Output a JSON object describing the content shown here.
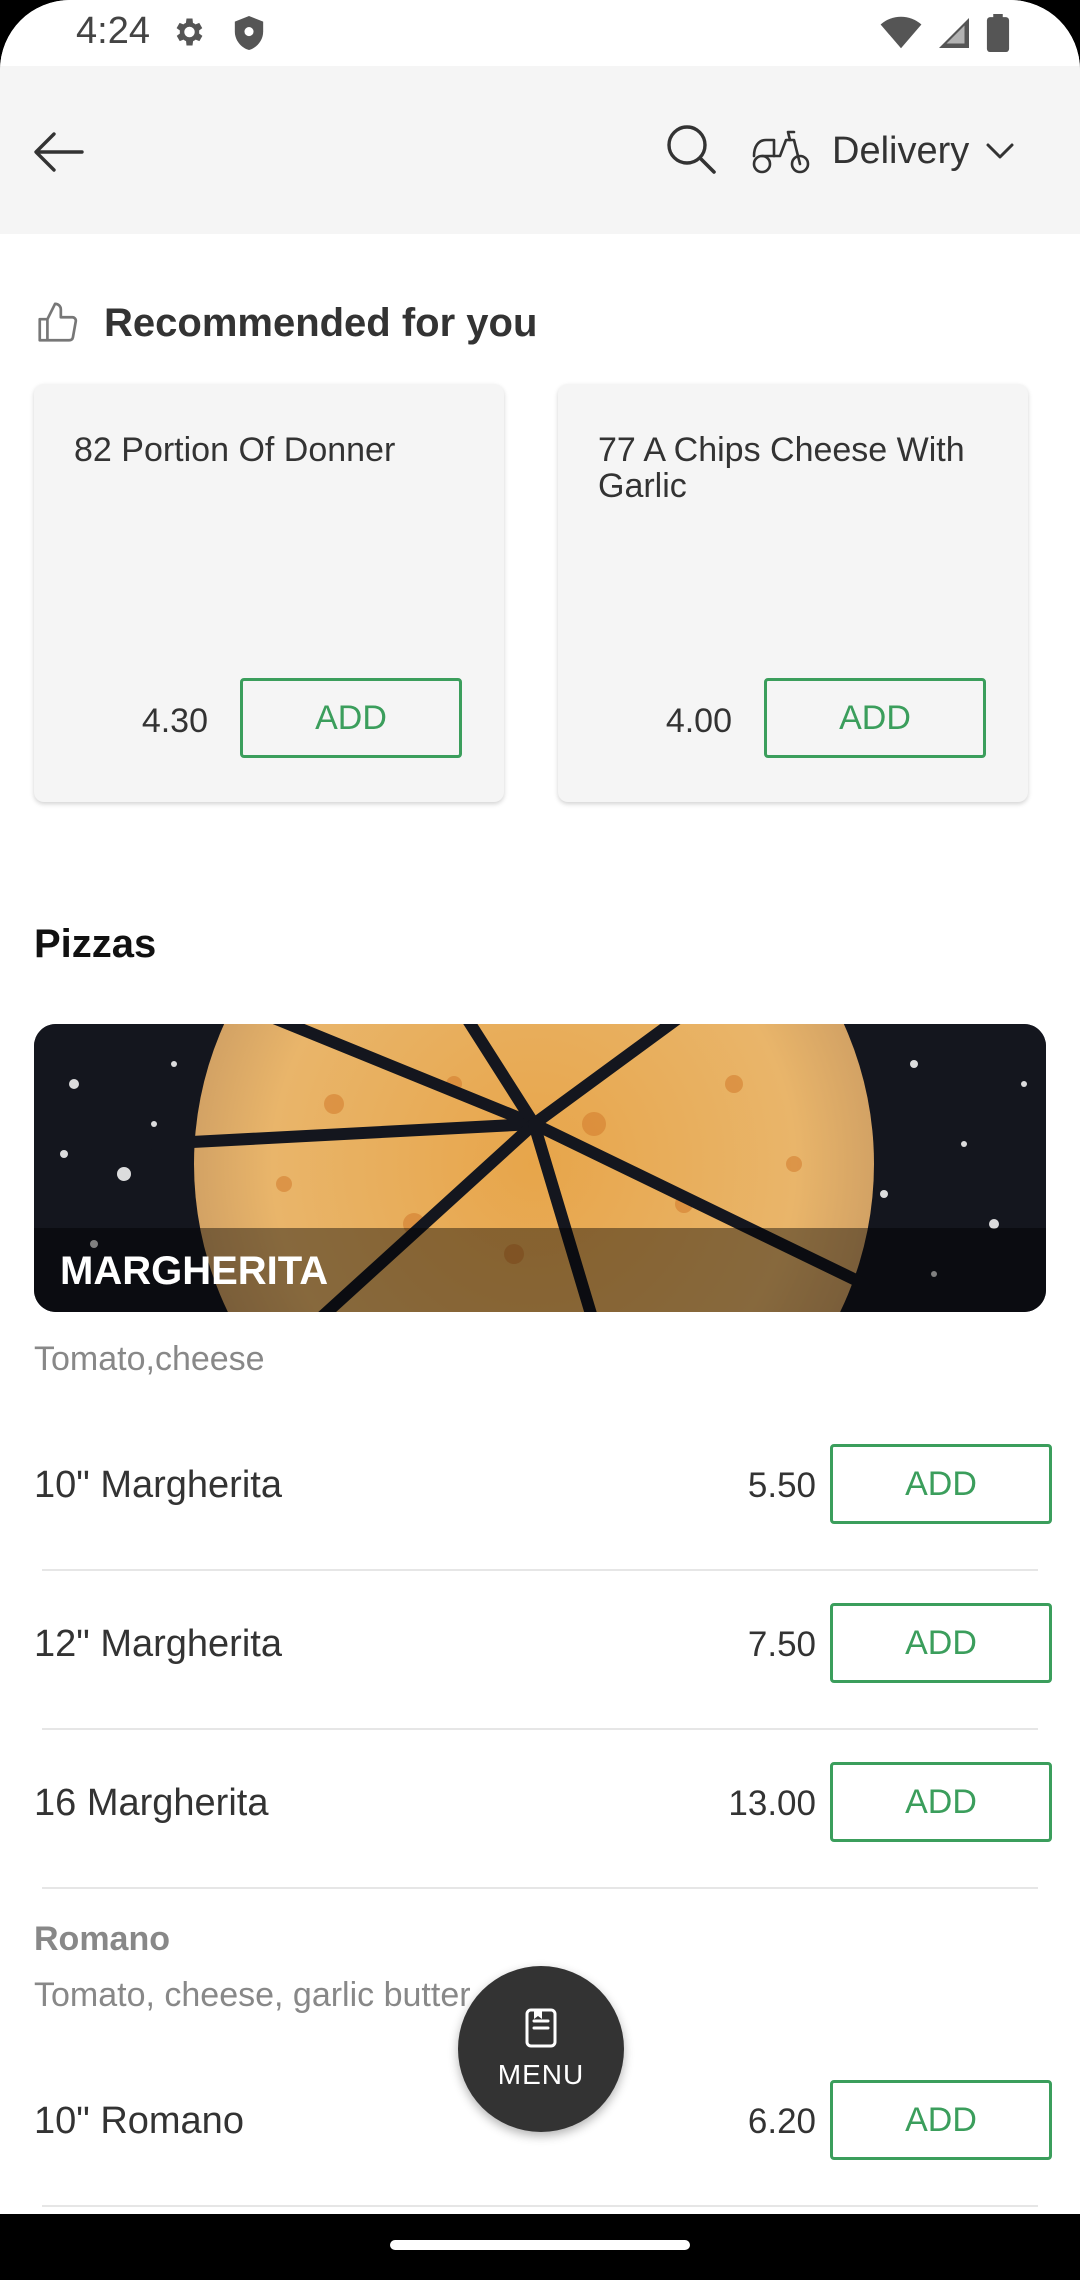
{
  "status_bar": {
    "time": "4:24",
    "icons": [
      "gear-icon",
      "shield-icon",
      "wifi-icon",
      "signal-icon",
      "battery-icon"
    ]
  },
  "app_bar": {
    "icons": [
      "back-arrow-icon",
      "search-icon",
      "scooter-icon"
    ],
    "delivery_mode": "Delivery"
  },
  "recommended": {
    "title": "Recommended for you",
    "icon": "thumbs-up-icon",
    "items": [
      {
        "name": "82 Portion Of Donner",
        "price": "4.30",
        "button": "ADD"
      },
      {
        "name": "77 A Chips Cheese With Garlic",
        "price": "4.00",
        "button": "ADD"
      }
    ]
  },
  "section": {
    "title": "Pizzas"
  },
  "category": {
    "name": "MARGHERITA",
    "description": "Tomato,cheese",
    "items": [
      {
        "name": "10\" Margherita",
        "price": "5.50",
        "button": "ADD"
      },
      {
        "name": "12\" Margherita",
        "price": "7.50",
        "button": "ADD"
      },
      {
        "name": "16 Margherita",
        "price": "13.00",
        "button": "ADD"
      }
    ]
  },
  "subcategory": {
    "name": "Romano",
    "description": "Tomato, cheese, garlic butter",
    "items": [
      {
        "name": "10\" Romano",
        "price": "6.20",
        "button": "ADD"
      }
    ]
  },
  "fab": {
    "label": "MENU",
    "icon": "menu-book-icon"
  },
  "colors": {
    "accent": "#3b9e5c",
    "app_bar_bg": "#f5f5f5",
    "fab_bg": "#333333"
  }
}
